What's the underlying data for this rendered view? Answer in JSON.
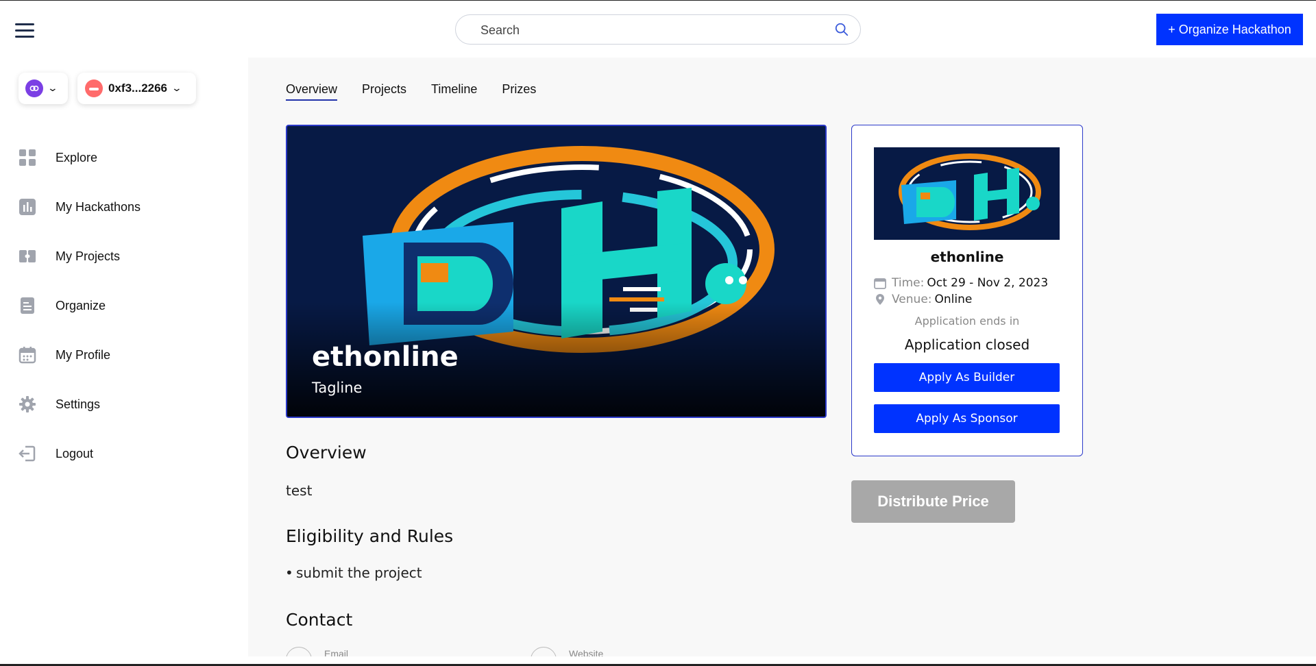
{
  "search": {
    "placeholder": "Search"
  },
  "header": {
    "organize_label": "+ Organize Hackathon"
  },
  "wallet": {
    "address": "0xf3...2266"
  },
  "sidebar": {
    "items": [
      {
        "label": "Explore",
        "icon": "grid-icon"
      },
      {
        "label": "My Hackathons",
        "icon": "chart-icon"
      },
      {
        "label": "My Projects",
        "icon": "tickets-icon"
      },
      {
        "label": "Organize",
        "icon": "document-icon"
      },
      {
        "label": "My Profile",
        "icon": "calendar-icon"
      },
      {
        "label": "Settings",
        "icon": "gear-icon"
      },
      {
        "label": "Logout",
        "icon": "logout-icon"
      }
    ]
  },
  "tabs": [
    {
      "label": "Overview",
      "active": true
    },
    {
      "label": "Projects",
      "active": false
    },
    {
      "label": "Timeline",
      "active": false
    },
    {
      "label": "Prizes",
      "active": false
    }
  ],
  "banner": {
    "title": "ethonline",
    "tagline": "Tagline"
  },
  "overview": {
    "heading": "Overview",
    "text": "test"
  },
  "rules": {
    "heading": "Eligibility and Rules",
    "items": [
      "submit the project"
    ]
  },
  "contact": {
    "heading": "Contact",
    "email_label": "Email",
    "website_label": "Website"
  },
  "card": {
    "title": "ethonline",
    "time_label": "Time:",
    "time_value": "Oct 29 - Nov 2, 2023",
    "venue_label": "Venue:",
    "venue_value": "Online",
    "application_ends": "Application ends in",
    "application_status": "Application closed",
    "apply_builder": "Apply As Builder",
    "apply_sponsor": "Apply As Sponsor"
  },
  "distribute": {
    "label": "Distribute Price"
  },
  "colors": {
    "accent": "#0033ff",
    "border": "#2b39c9",
    "banner_bg": "#0a1a46",
    "disabled": "#a8a8a8"
  }
}
